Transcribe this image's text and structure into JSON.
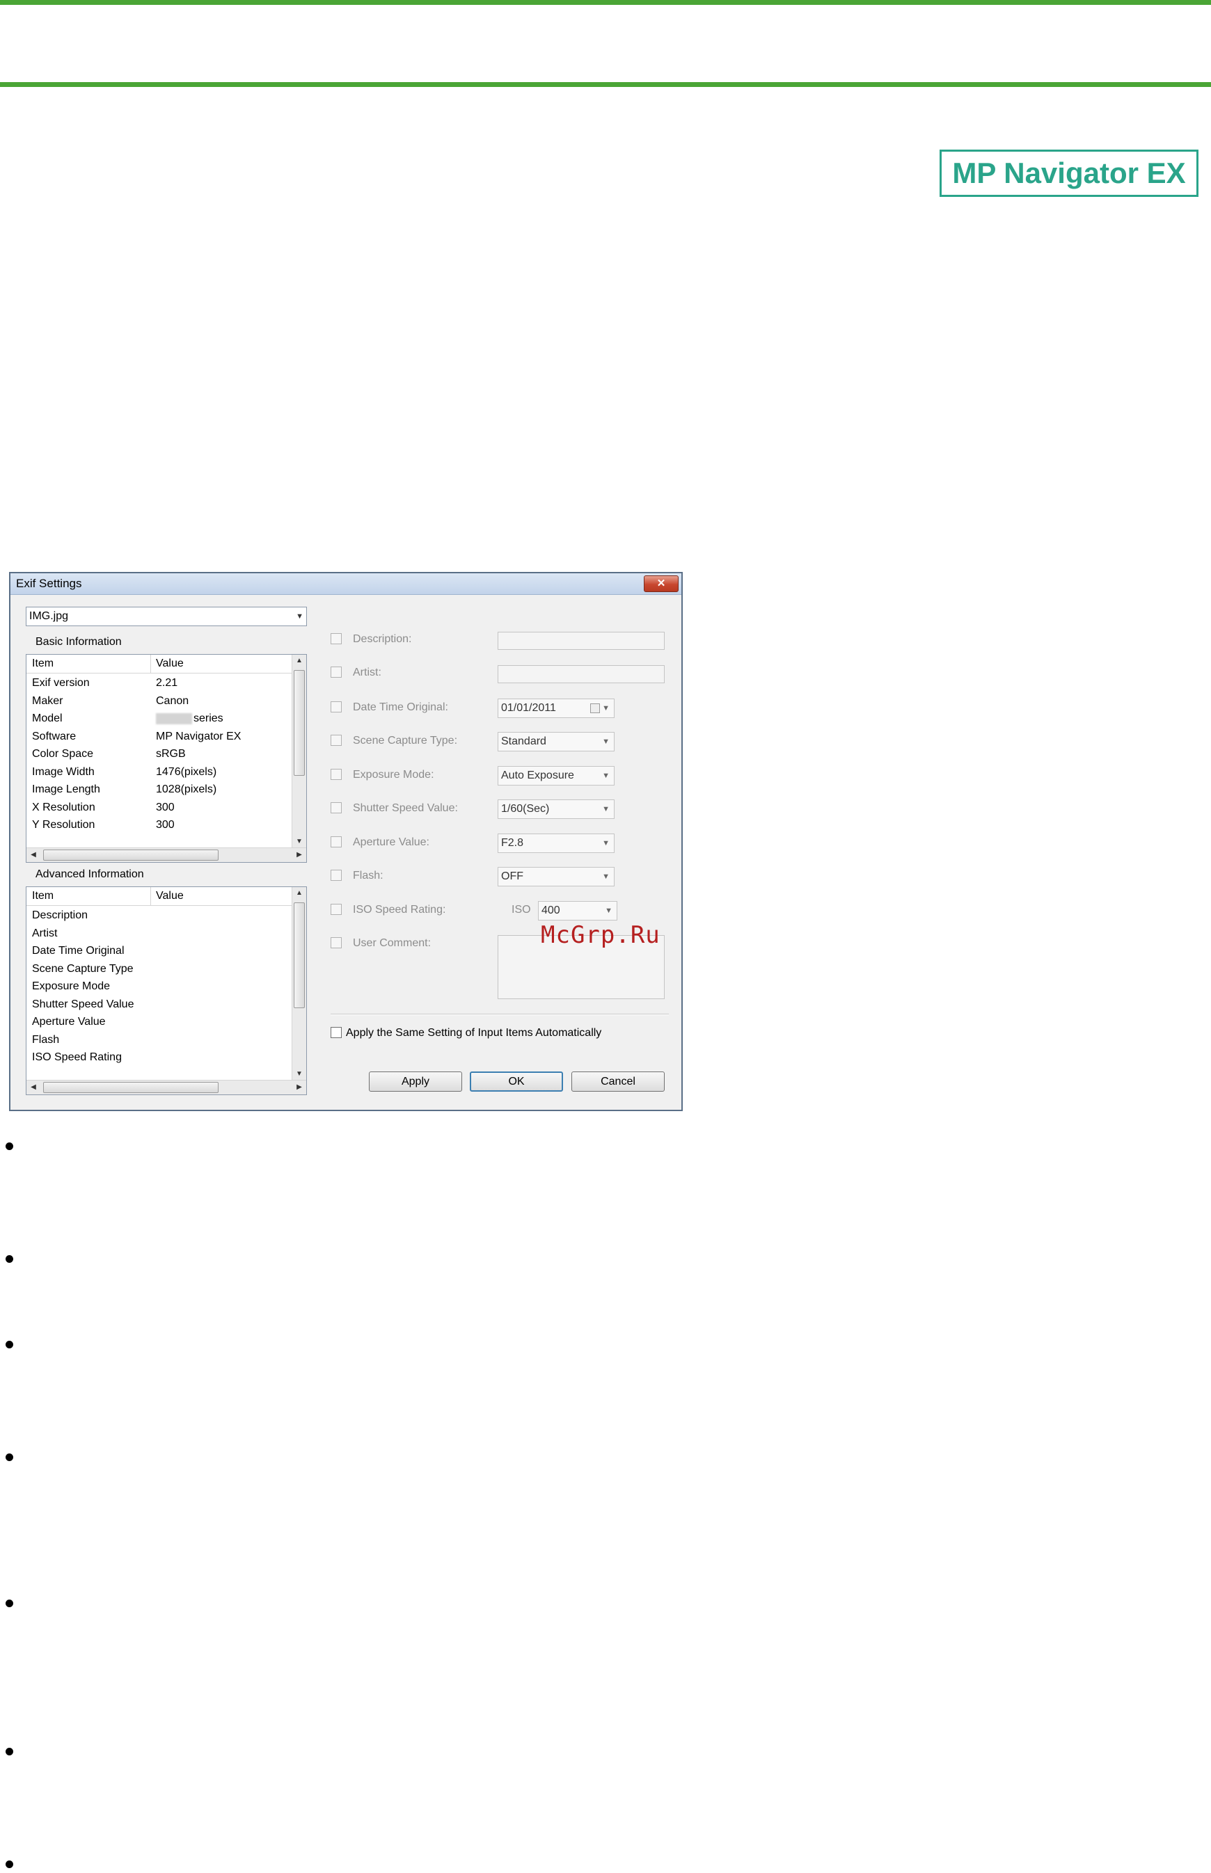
{
  "logo": {
    "text": "MP Navigator EX",
    "color": "#2aa48a"
  },
  "dialog": {
    "title": "Exif Settings",
    "close_label": "✕",
    "file_select": "IMG.jpg",
    "basic": {
      "label": "Basic Information",
      "col_item": "Item",
      "col_value": "Value",
      "rows": [
        {
          "item": "Exif version",
          "value": "2.21"
        },
        {
          "item": "Maker",
          "value": "Canon"
        },
        {
          "item": "Model",
          "value": "series"
        },
        {
          "item": "Software",
          "value": "MP Navigator EX"
        },
        {
          "item": "Color Space",
          "value": "sRGB"
        },
        {
          "item": "Image Width",
          "value": "1476(pixels)"
        },
        {
          "item": "Image Length",
          "value": "1028(pixels)"
        },
        {
          "item": "X Resolution",
          "value": "300"
        },
        {
          "item": "Y Resolution",
          "value": "300"
        }
      ]
    },
    "advanced": {
      "label": "Advanced Information",
      "col_item": "Item",
      "col_value": "Value",
      "rows": [
        {
          "item": "Description"
        },
        {
          "item": "Artist"
        },
        {
          "item": "Date Time Original"
        },
        {
          "item": "Scene Capture Type"
        },
        {
          "item": "Exposure Mode"
        },
        {
          "item": "Shutter Speed Value"
        },
        {
          "item": "Aperture Value"
        },
        {
          "item": "Flash"
        },
        {
          "item": "ISO Speed Rating"
        }
      ]
    },
    "fields": {
      "description": "Description:",
      "artist": "Artist:",
      "date_time_original": {
        "label": "Date Time Original:",
        "value": "01/01/2011"
      },
      "scene_capture_type": {
        "label": "Scene Capture Type:",
        "value": "Standard"
      },
      "exposure_mode": {
        "label": "Exposure Mode:",
        "value": "Auto Exposure"
      },
      "shutter_speed_value": {
        "label": "Shutter Speed Value:",
        "value": "1/60(Sec)"
      },
      "aperture_value": {
        "label": "Aperture Value:",
        "value": "F2.8"
      },
      "flash": {
        "label": "Flash:",
        "value": "OFF"
      },
      "iso_speed_rating": {
        "label": "ISO Speed Rating:",
        "prefix": "ISO",
        "value": "400"
      },
      "user_comment": "User Comment:"
    },
    "apply_same_setting": "Apply the Same Setting of Input Items Automatically",
    "buttons": {
      "apply": "Apply",
      "ok": "OK",
      "cancel": "Cancel"
    },
    "watermark": "McGrp.Ru"
  }
}
